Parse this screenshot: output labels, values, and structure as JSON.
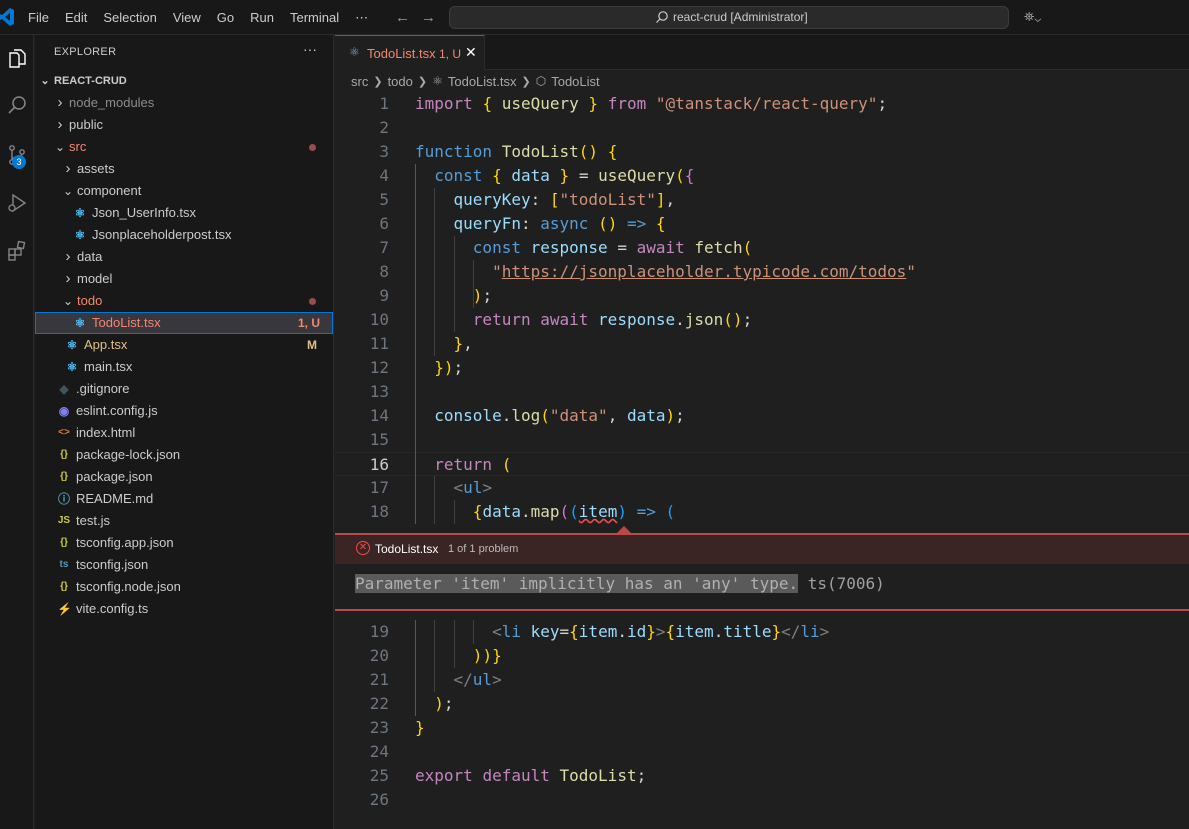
{
  "titlebar": {
    "menu": [
      "File",
      "Edit",
      "Selection",
      "View",
      "Go",
      "Run",
      "Terminal",
      "⋯"
    ],
    "search_text": "react-crud [Administrator]"
  },
  "activity": {
    "scm_badge": "3"
  },
  "sidebar": {
    "title": "EXPLORER",
    "more": "···",
    "root": "REACT-CRUD",
    "items": [
      {
        "label": "node_modules",
        "kind": "folder",
        "depth": 1,
        "state": "collapsed",
        "color": "#8c8c8c"
      },
      {
        "label": "public",
        "kind": "folder",
        "depth": 1,
        "state": "collapsed",
        "color": "#cccccc"
      },
      {
        "label": "src",
        "kind": "folder",
        "depth": 1,
        "state": "expanded",
        "color": "#f48771",
        "dot": true
      },
      {
        "label": "assets",
        "kind": "folder",
        "depth": 2,
        "state": "collapsed",
        "color": "#cccccc"
      },
      {
        "label": "component",
        "kind": "folder",
        "depth": 2,
        "state": "expanded",
        "color": "#cccccc"
      },
      {
        "label": "Json_UserInfo.tsx",
        "kind": "react",
        "depth": 3,
        "color": "#cccccc"
      },
      {
        "label": "Jsonplaceholderpost.tsx",
        "kind": "react",
        "depth": 3,
        "color": "#cccccc"
      },
      {
        "label": "data",
        "kind": "folder",
        "depth": 2,
        "state": "collapsed",
        "color": "#cccccc"
      },
      {
        "label": "model",
        "kind": "folder",
        "depth": 2,
        "state": "collapsed",
        "color": "#cccccc"
      },
      {
        "label": "todo",
        "kind": "folder",
        "depth": 2,
        "state": "expanded",
        "color": "#f48771",
        "dot": true
      },
      {
        "label": "TodoList.tsx",
        "kind": "react",
        "depth": 3,
        "color": "#f48771",
        "status": "1, U",
        "selected": true
      },
      {
        "label": "App.tsx",
        "kind": "react",
        "depth": 2,
        "color": "#e2c08d",
        "status": "M"
      },
      {
        "label": "main.tsx",
        "kind": "react",
        "depth": 2,
        "color": "#cccccc"
      },
      {
        "label": ".gitignore",
        "kind": "git",
        "depth": 1,
        "color": "#cccccc"
      },
      {
        "label": "eslint.config.js",
        "kind": "eslint",
        "depth": 1,
        "color": "#cccccc"
      },
      {
        "label": "index.html",
        "kind": "html",
        "depth": 1,
        "color": "#cccccc"
      },
      {
        "label": "package-lock.json",
        "kind": "json",
        "depth": 1,
        "color": "#cccccc"
      },
      {
        "label": "package.json",
        "kind": "json",
        "depth": 1,
        "color": "#cccccc"
      },
      {
        "label": "README.md",
        "kind": "info",
        "depth": 1,
        "color": "#cccccc"
      },
      {
        "label": "test.js",
        "kind": "js",
        "depth": 1,
        "color": "#cccccc"
      },
      {
        "label": "tsconfig.app.json",
        "kind": "json",
        "depth": 1,
        "color": "#cccccc"
      },
      {
        "label": "tsconfig.json",
        "kind": "ts",
        "depth": 1,
        "color": "#cccccc"
      },
      {
        "label": "tsconfig.node.json",
        "kind": "json",
        "depth": 1,
        "color": "#cccccc"
      },
      {
        "label": "vite.config.ts",
        "kind": "vite",
        "depth": 1,
        "color": "#cccccc"
      }
    ]
  },
  "tab": {
    "label": "TodoList.tsx",
    "status": "1, U",
    "close": "✕"
  },
  "breadcrumb": {
    "parts": [
      "src",
      "todo",
      "TodoList.tsx",
      "TodoList"
    ]
  },
  "editor": {
    "current_line": "16",
    "lines_top": [
      {
        "n": "1",
        "text": "import { useQuery } from \"@tanstack/react-query\";"
      },
      {
        "n": "2",
        "text": ""
      },
      {
        "n": "3",
        "text": "function TodoList() {"
      },
      {
        "n": "4",
        "text": "  const { data } = useQuery({"
      },
      {
        "n": "5",
        "text": "    queryKey: [\"todoList\"],"
      },
      {
        "n": "6",
        "text": "    queryFn: async () => {"
      },
      {
        "n": "7",
        "text": "      const response = await fetch("
      },
      {
        "n": "8",
        "text": "        \"https://jsonplaceholder.typicode.com/todos\""
      },
      {
        "n": "9",
        "text": "      );"
      },
      {
        "n": "10",
        "text": "      return await response.json();"
      },
      {
        "n": "11",
        "text": "    },"
      },
      {
        "n": "12",
        "text": "  });"
      },
      {
        "n": "13",
        "text": ""
      },
      {
        "n": "14",
        "text": "  console.log(\"data\", data);"
      },
      {
        "n": "15",
        "text": ""
      },
      {
        "n": "16",
        "text": "  return ("
      },
      {
        "n": "17",
        "text": "    <ul>"
      },
      {
        "n": "18",
        "text": "      {data.map((item) => ("
      }
    ],
    "lines_bottom": [
      {
        "n": "19",
        "text": "        <li key={item.id}>{item.title}</li>"
      },
      {
        "n": "20",
        "text": "      ))}"
      },
      {
        "n": "21",
        "text": "    </ul>"
      },
      {
        "n": "22",
        "text": "  );"
      },
      {
        "n": "23",
        "text": "}"
      },
      {
        "n": "24",
        "text": ""
      },
      {
        "n": "25",
        "text": "export default TodoList;"
      },
      {
        "n": "26",
        "text": ""
      }
    ]
  },
  "problem": {
    "file": "TodoList.tsx",
    "count": "1 of 1 problem",
    "message": "Parameter 'item' implicitly has an 'any' type.",
    "code": "ts(7006)"
  },
  "colors": {
    "accent": "#0078d4",
    "error": "#f14c4c",
    "untracked": "#f48771",
    "modified": "#e2c08d"
  }
}
